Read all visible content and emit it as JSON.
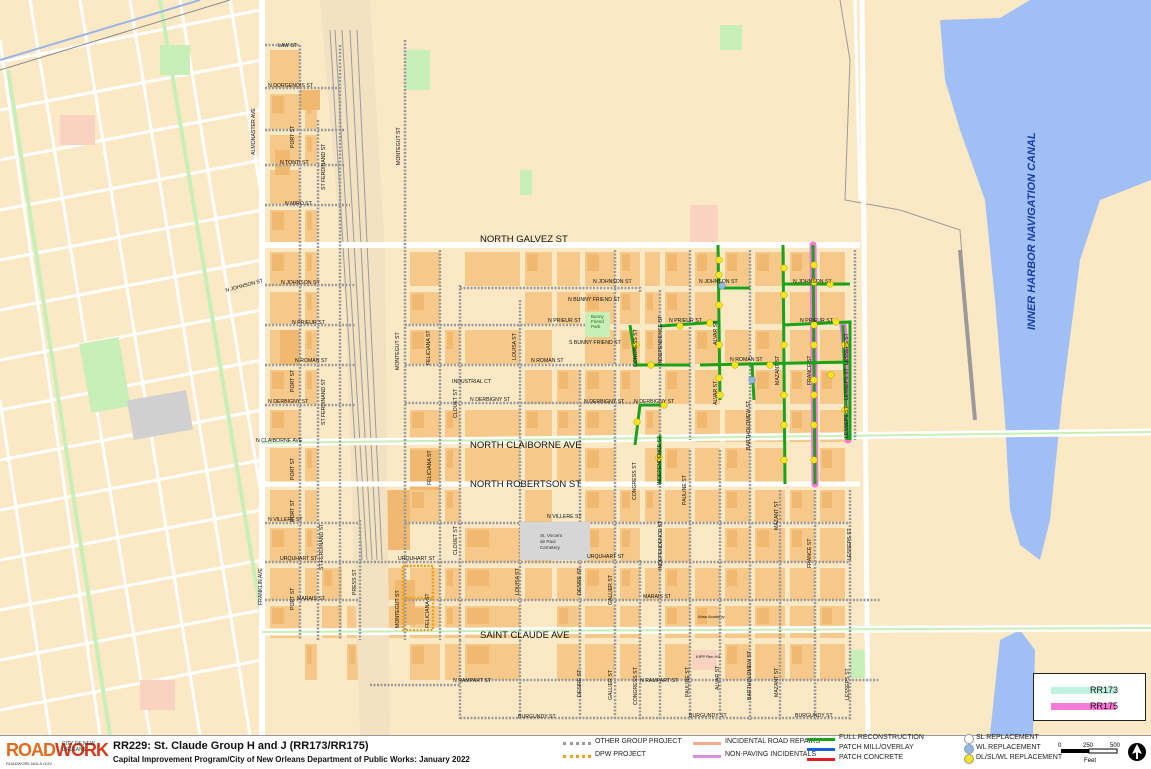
{
  "map": {
    "street_labels_major": [
      "NORTH GALVEZ ST",
      "NORTH CLAIBORNE AVE",
      "NORTH ROBERTSON ST",
      "SAINT CLAUDE AVE"
    ],
    "canal_label": "INNER HARBOR NAVIGATION CANAL",
    "street_labels": {
      "law": "LAW ST",
      "dorgenois": "N DORGENOIS ST",
      "almonaster": "ALMONASTER AVE",
      "port1": "PORT ST",
      "tonti": "N TONTI ST",
      "ferdinand1": "ST FERDINAND ST",
      "miro": "N MIRO ST",
      "montegut1": "MONTEGUT ST",
      "johnson_w": "N JOHNSON ST",
      "johnson1": "N JOHNSON ST",
      "prieur1": "N PRIEUR ST",
      "roman1": "N ROMAN ST",
      "montegut2": "MONTEGUT ST",
      "feliciana1": "FELICIANA ST",
      "port2": "PORT ST",
      "ferdinand2": "ST FERDINAND ST",
      "derbigny1": "N DERBIGNY ST",
      "claiborne_w": "N CLAIBORNE AVE",
      "port3": "PORT ST",
      "feliciana2": "FELICIANA ST",
      "cloue1": "CLOUET ST",
      "industrial": "INDUSTRIAL CT",
      "derbigny2": "N DERBIGNY ST",
      "louisa1": "LOUISA ST",
      "roman2": "N ROMAN ST",
      "johnson2": "N JOHNSON ST",
      "bunny1": "N BUNNY FRIEND ST",
      "prieur2": "N PRIEUR ST",
      "bunny2": "S BUNNY FRIEND ST",
      "park": "Bunny Friend Park",
      "congress1": "CONGRESS ST",
      "independence1": "INDEPENDENCE ST",
      "prieur3": "N PRIEUR ST",
      "alvar1": "ALVAR ST",
      "johnson3": "N JOHNSON ST",
      "johnson4": "N JOHNSON ST",
      "prieur4": "N PRIEUR ST",
      "roman3": "N ROMAN ST",
      "mazant1": "MAZANT ST",
      "france1": "FRANCE ST",
      "lesseps1": "LESSEPS ST",
      "lesseps2": "LESSEPS ST",
      "lesseps3": "LESSEPS ST",
      "alvar2": "ALVAR ST",
      "bartholomew1": "BARTHOLOMEW ST",
      "derbigny3": "N DERBIGNY ST",
      "derbigny4": "N DERBIGNY ST",
      "congress2": "CONGRESS ST",
      "independence2": "INDEPENDENCE ST",
      "pauline1": "PAULINE ST",
      "mazant2": "MAZANT ST",
      "villere1": "N VILLERE ST",
      "villere2": "N VILLERE ST",
      "port4": "PORT ST",
      "ferdinand3": "ST FERDINAND ST",
      "urquhart1": "URQUHART ST",
      "urquhart2": "URQUHART ST",
      "urquhart3": "URQUHART ST",
      "franklin": "FRANKLIN AVE",
      "port5": "PORT ST",
      "marais1": "MARAIS ST",
      "press": "PRESS ST",
      "montegut3": "MONTEGUT ST",
      "feliciana3": "FELICIANA ST",
      "cloue2": "CLOUET ST",
      "louisa2": "LOUISA ST",
      "cemetery": "St. Vincent de Paul Cemetery",
      "desire1": "DESIRE ST",
      "gallier1": "GALLIER ST",
      "independence3": "INDEPENDENCE ST",
      "marais2": "MARAIS ST",
      "france2": "FRANCE ST",
      "lesseps4": "LESSEPS ST",
      "arise": "Arise Academy",
      "rampart1": "N RAMPART ST",
      "rampart2": "N RAMPART ST",
      "desire2": "DESIRE ST",
      "gallier2": "GALLIER ST",
      "congress3": "CONGRESS ST",
      "pauline2": "PAULINE ST",
      "alvar3": "ALVAR ST",
      "bartholomew2": "BARTHOLOMEW ST",
      "mazant3": "MAZANT ST",
      "lesseps5": "LESSEPS ST",
      "burgundy1": "BURGUNDY ST",
      "burgundy2": "BURGUNDY ST",
      "burgundy3": "BURGUNDY ST",
      "kipp": "KIPP Ren HS"
    }
  },
  "legend_box": {
    "items": [
      {
        "label": "RR173",
        "color": "#bff2df"
      },
      {
        "label": "RR175",
        "color": "#f77ad6"
      }
    ]
  },
  "footer": {
    "logo_road": "ROAD",
    "logo_work": "WORK",
    "logo_city": "CITY OF NEW ORLEANS",
    "logo_url": "ROADWORK.NOLA.GOV",
    "title": "RR229:  St. Claude Group H and J (RR173/RR175)",
    "subtitle": "Capital Improvement Program/City of New Orleans Department of Public Works:  January 2022",
    "legend": [
      {
        "label": "OTHER GROUP PROJECT",
        "color": "#9a9a9a",
        "style": "dashed"
      },
      {
        "label": "DPW PROJECT",
        "color": "#f2a01c",
        "style": "dashed"
      },
      {
        "label": "INCIDENTAL ROAD REPAIRS",
        "color": "#f4a98a",
        "style": "solid"
      },
      {
        "label": "NON-PAVING INCIDENTALS",
        "color": "#d98ee0",
        "style": "solid"
      },
      {
        "label": "FULL RECONSTRUCTION",
        "color": "#1aa31a",
        "style": "solid"
      },
      {
        "label": "PATCH MILL/OVERLAY",
        "color": "#1f5fd6",
        "style": "solid"
      },
      {
        "label": "PATCH CONCRETE",
        "color": "#e02020",
        "style": "solid"
      },
      {
        "label": "SL REPLACEMENT",
        "color": "#ffffff",
        "style": "dot"
      },
      {
        "label": "WL REPLACEMENT",
        "color": "#8fb8e8",
        "style": "dot"
      },
      {
        "label": "DL/SL/WL REPLACEMENT",
        "color": "#f5e51c",
        "style": "dot"
      }
    ],
    "scale_ticks": [
      "0",
      "250",
      "500"
    ],
    "scale_unit": "Feet"
  },
  "colors": {
    "background": "#fbe9c6",
    "parcel": "#f6c98a",
    "water": "#9fbff5",
    "park": "#c8efb8",
    "road": "#ffffff",
    "full_reconstruction": "#1aa31a",
    "rr175": "#f77ad6",
    "dpw": "#f2a01c",
    "other_group": "#9a9a9a"
  }
}
